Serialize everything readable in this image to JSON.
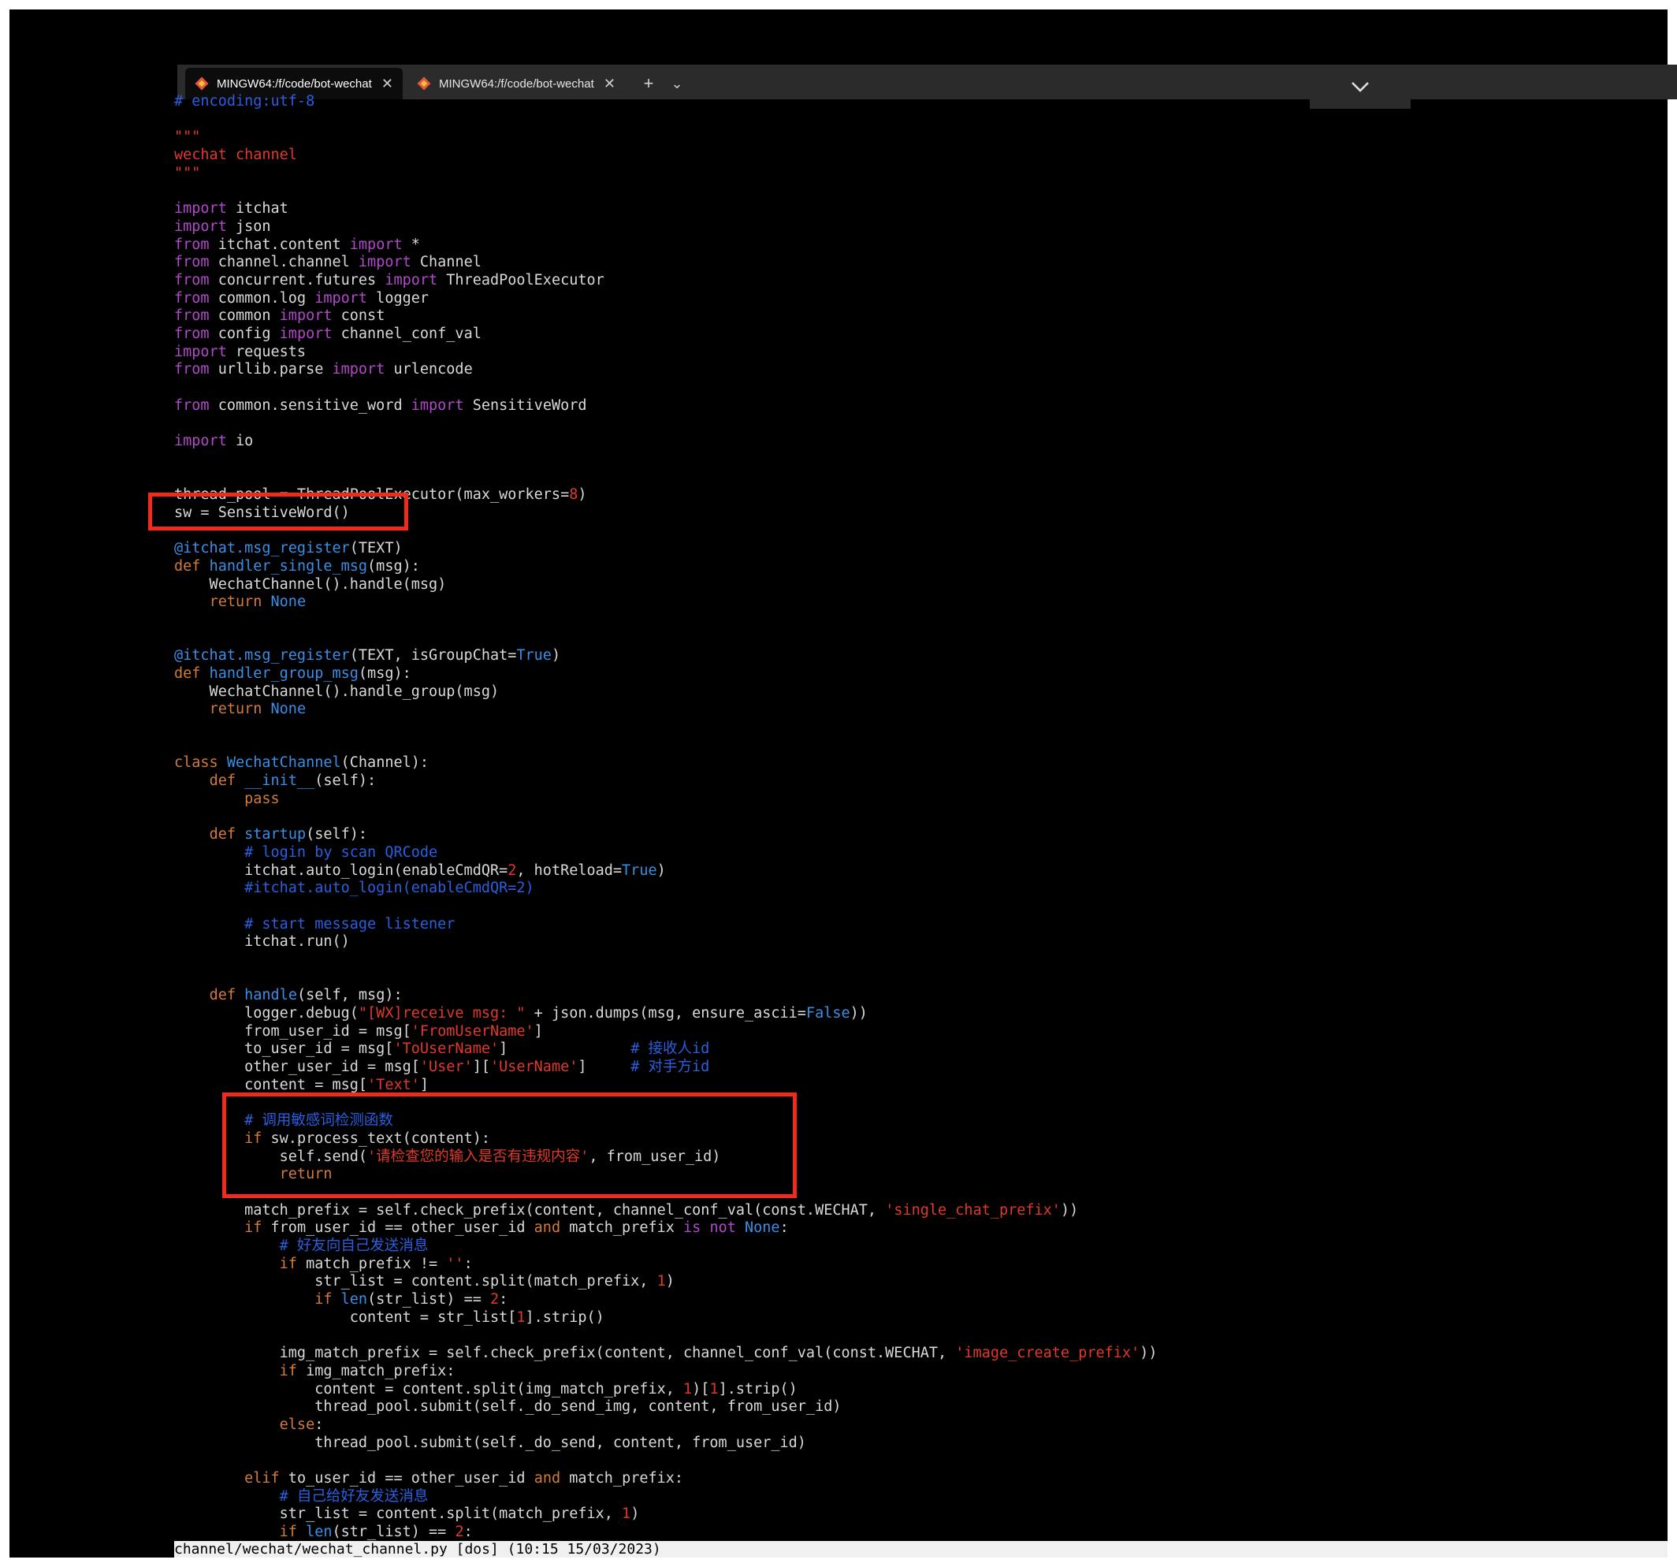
{
  "tabs": [
    {
      "label": "MINGW64:/f/code/bot-wechat",
      "active": true
    },
    {
      "label": "MINGW64:/f/code/bot-wechat",
      "active": false
    }
  ],
  "new_tab_label": "+",
  "dropdown_label": "⌄",
  "status_line": "channel/wechat/wechat_channel.py [dos] (10:15 15/03/2023)",
  "code_lines": [
    [
      [
        "# encoding:utf-8",
        "cm"
      ]
    ],
    [],
    [
      [
        "\"\"\"",
        "st"
      ]
    ],
    [
      [
        "wechat channel",
        "st"
      ]
    ],
    [
      [
        "\"\"\"",
        "st"
      ]
    ],
    [],
    [
      [
        "import",
        "kw"
      ],
      [
        " itchat",
        ""
      ]
    ],
    [
      [
        "import",
        "kw"
      ],
      [
        " json",
        ""
      ]
    ],
    [
      [
        "from",
        "kw"
      ],
      [
        " itchat.content ",
        ""
      ],
      [
        "import",
        "kw"
      ],
      [
        " *",
        ""
      ]
    ],
    [
      [
        "from",
        "kw"
      ],
      [
        " channel.channel ",
        ""
      ],
      [
        "import",
        "kw"
      ],
      [
        " Channel",
        ""
      ]
    ],
    [
      [
        "from",
        "kw"
      ],
      [
        " concurrent.futures ",
        ""
      ],
      [
        "import",
        "kw"
      ],
      [
        " ThreadPoolExecutor",
        ""
      ]
    ],
    [
      [
        "from",
        "kw"
      ],
      [
        " common.log ",
        ""
      ],
      [
        "import",
        "kw"
      ],
      [
        " logger",
        ""
      ]
    ],
    [
      [
        "from",
        "kw"
      ],
      [
        " common ",
        ""
      ],
      [
        "import",
        "kw"
      ],
      [
        " const",
        ""
      ]
    ],
    [
      [
        "from",
        "kw"
      ],
      [
        " config ",
        ""
      ],
      [
        "import",
        "kw"
      ],
      [
        " channel_conf_val",
        ""
      ]
    ],
    [
      [
        "import",
        "kw"
      ],
      [
        " requests",
        ""
      ]
    ],
    [
      [
        "from",
        "kw"
      ],
      [
        " urllib.parse ",
        ""
      ],
      [
        "import",
        "kw"
      ],
      [
        " urlencode",
        ""
      ]
    ],
    [],
    [
      [
        "from",
        "kw"
      ],
      [
        " common.sensitive_word ",
        ""
      ],
      [
        "import",
        "kw"
      ],
      [
        " SensitiveWord",
        ""
      ]
    ],
    [],
    [
      [
        "import",
        "kw"
      ],
      [
        " io",
        ""
      ]
    ],
    [],
    [],
    [
      [
        "thread_pool = ThreadPoolExecutor(max_workers=",
        ""
      ],
      [
        "8",
        "nu"
      ],
      [
        ")",
        ""
      ]
    ],
    [
      [
        "sw = SensitiveWord()",
        ""
      ]
    ],
    [],
    [
      [
        "@itchat.msg_register",
        "fn"
      ],
      [
        "(TEXT)",
        ""
      ]
    ],
    [
      [
        "def",
        "kr"
      ],
      [
        " ",
        ""
      ],
      [
        "handler_single_msg",
        "fn"
      ],
      [
        "(msg):",
        ""
      ]
    ],
    [
      [
        "    WechatChannel().handle(msg)",
        ""
      ]
    ],
    [
      [
        "    ",
        ""
      ],
      [
        "return",
        "kr"
      ],
      [
        " ",
        ""
      ],
      [
        "None",
        "cn"
      ]
    ],
    [],
    [],
    [
      [
        "@itchat.msg_register",
        "fn"
      ],
      [
        "(TEXT, isGroupChat=",
        ""
      ],
      [
        "True",
        "cn"
      ],
      [
        ")",
        ""
      ]
    ],
    [
      [
        "def",
        "kr"
      ],
      [
        " ",
        ""
      ],
      [
        "handler_group_msg",
        "fn"
      ],
      [
        "(msg):",
        ""
      ]
    ],
    [
      [
        "    WechatChannel().handle_group(msg)",
        ""
      ]
    ],
    [
      [
        "    ",
        ""
      ],
      [
        "return",
        "kr"
      ],
      [
        " ",
        ""
      ],
      [
        "None",
        "cn"
      ]
    ],
    [],
    [],
    [
      [
        "class",
        "kr"
      ],
      [
        " ",
        ""
      ],
      [
        "WechatChannel",
        "fn"
      ],
      [
        "(Channel):",
        ""
      ]
    ],
    [
      [
        "    ",
        ""
      ],
      [
        "def",
        "kr"
      ],
      [
        " ",
        ""
      ],
      [
        "__init__",
        "fn"
      ],
      [
        "(self):",
        ""
      ]
    ],
    [
      [
        "        ",
        ""
      ],
      [
        "pass",
        "kr"
      ]
    ],
    [],
    [
      [
        "    ",
        ""
      ],
      [
        "def",
        "kr"
      ],
      [
        " ",
        ""
      ],
      [
        "startup",
        "fn"
      ],
      [
        "(self):",
        ""
      ]
    ],
    [
      [
        "        ",
        ""
      ],
      [
        "# login by scan QRCode",
        "cm"
      ]
    ],
    [
      [
        "        itchat.auto_login(enableCmdQR=",
        ""
      ],
      [
        "2",
        "nu"
      ],
      [
        ", hotReload=",
        ""
      ],
      [
        "True",
        "cn"
      ],
      [
        ")",
        ""
      ]
    ],
    [
      [
        "        ",
        ""
      ],
      [
        "#itchat.auto_login(enableCmdQR=2)",
        "cm"
      ]
    ],
    [],
    [
      [
        "        ",
        ""
      ],
      [
        "# start message listener",
        "cm"
      ]
    ],
    [
      [
        "        itchat.run()",
        ""
      ]
    ],
    [],
    [],
    [
      [
        "    ",
        ""
      ],
      [
        "def",
        "kr"
      ],
      [
        " ",
        ""
      ],
      [
        "handle",
        "fn"
      ],
      [
        "(self, msg):",
        ""
      ]
    ],
    [
      [
        "        logger.debug(",
        ""
      ],
      [
        "\"[WX]receive msg: \"",
        "st"
      ],
      [
        " + json.dumps(msg, ensure_ascii=",
        ""
      ],
      [
        "False",
        "cn"
      ],
      [
        "))",
        ""
      ]
    ],
    [
      [
        "        from_user_id = msg[",
        ""
      ],
      [
        "'FromUserName'",
        "st"
      ],
      [
        "]",
        ""
      ]
    ],
    [
      [
        "        to_user_id = msg[",
        ""
      ],
      [
        "'ToUserName'",
        "st"
      ],
      [
        "]              ",
        ""
      ],
      [
        "# 接收人id",
        "cm"
      ]
    ],
    [
      [
        "        other_user_id = msg[",
        ""
      ],
      [
        "'User'",
        "st"
      ],
      [
        "][",
        ""
      ],
      [
        "'UserName'",
        "st"
      ],
      [
        "]     ",
        ""
      ],
      [
        "# 对手方id",
        "cm"
      ]
    ],
    [
      [
        "        content = msg[",
        ""
      ],
      [
        "'Text'",
        "st"
      ],
      [
        "]",
        ""
      ]
    ],
    [],
    [
      [
        "        ",
        ""
      ],
      [
        "# 调用敏感词检测函数",
        "cm"
      ]
    ],
    [
      [
        "        ",
        ""
      ],
      [
        "if",
        "kr"
      ],
      [
        " sw.process_text(content):",
        ""
      ]
    ],
    [
      [
        "            self.send(",
        ""
      ],
      [
        "'请检查您的输入是否有违规内容'",
        "st"
      ],
      [
        ", from_user_id)",
        ""
      ]
    ],
    [
      [
        "            ",
        ""
      ],
      [
        "return",
        "kr"
      ]
    ],
    [],
    [
      [
        "        match_prefix = self.check_prefix(content, channel_conf_val(const.WECHAT, ",
        ""
      ],
      [
        "'single_chat_prefix'",
        "st"
      ],
      [
        "))",
        ""
      ]
    ],
    [
      [
        "        ",
        ""
      ],
      [
        "if",
        "kr"
      ],
      [
        " from_user_id == other_user_id ",
        ""
      ],
      [
        "and",
        "kr"
      ],
      [
        " match_prefix ",
        ""
      ],
      [
        "is not",
        "kw"
      ],
      [
        " ",
        ""
      ],
      [
        "None",
        "cn"
      ],
      [
        ":",
        ""
      ]
    ],
    [
      [
        "            ",
        ""
      ],
      [
        "# 好友向自己发送消息",
        "cm"
      ]
    ],
    [
      [
        "            ",
        ""
      ],
      [
        "if",
        "kr"
      ],
      [
        " match_prefix != ",
        ""
      ],
      [
        "''",
        "st"
      ],
      [
        ":",
        ""
      ]
    ],
    [
      [
        "                str_list = content.split(match_prefix, ",
        ""
      ],
      [
        "1",
        "nu"
      ],
      [
        ")",
        ""
      ]
    ],
    [
      [
        "                ",
        ""
      ],
      [
        "if",
        "kr"
      ],
      [
        " ",
        ""
      ],
      [
        "len",
        "fn"
      ],
      [
        "(str_list) == ",
        ""
      ],
      [
        "2",
        "nu"
      ],
      [
        ":",
        ""
      ]
    ],
    [
      [
        "                    content = str_list[",
        ""
      ],
      [
        "1",
        "nu"
      ],
      [
        "].strip()",
        ""
      ]
    ],
    [],
    [
      [
        "            img_match_prefix = self.check_prefix(content, channel_conf_val(const.WECHAT, ",
        ""
      ],
      [
        "'image_create_prefix'",
        "st"
      ],
      [
        "))",
        ""
      ]
    ],
    [
      [
        "            ",
        ""
      ],
      [
        "if",
        "kr"
      ],
      [
        " img_match_prefix:",
        ""
      ]
    ],
    [
      [
        "                content = content.split(img_match_prefix, ",
        ""
      ],
      [
        "1",
        "nu"
      ],
      [
        ")[",
        ""
      ],
      [
        "1",
        "nu"
      ],
      [
        "].strip()",
        ""
      ]
    ],
    [
      [
        "                thread_pool.submit(self._do_send_img, content, from_user_id)",
        ""
      ]
    ],
    [
      [
        "            ",
        ""
      ],
      [
        "else",
        "kr"
      ],
      [
        ":",
        ""
      ]
    ],
    [
      [
        "                thread_pool.submit(self._do_send, content, from_user_id)",
        ""
      ]
    ],
    [],
    [
      [
        "        ",
        ""
      ],
      [
        "elif",
        "kr"
      ],
      [
        " to_user_id == other_user_id ",
        ""
      ],
      [
        "and",
        "kr"
      ],
      [
        " match_prefix:",
        ""
      ]
    ],
    [
      [
        "            ",
        ""
      ],
      [
        "# 自己给好友发送消息",
        "cm"
      ]
    ],
    [
      [
        "            str_list = content.split(match_prefix, ",
        ""
      ],
      [
        "1",
        "nu"
      ],
      [
        ")",
        ""
      ]
    ],
    [
      [
        "            ",
        ""
      ],
      [
        "if",
        "kr"
      ],
      [
        " ",
        ""
      ],
      [
        "len",
        "fn"
      ],
      [
        "(str_list) == ",
        ""
      ],
      [
        "2",
        "nu"
      ],
      [
        ":",
        ""
      ]
    ]
  ]
}
